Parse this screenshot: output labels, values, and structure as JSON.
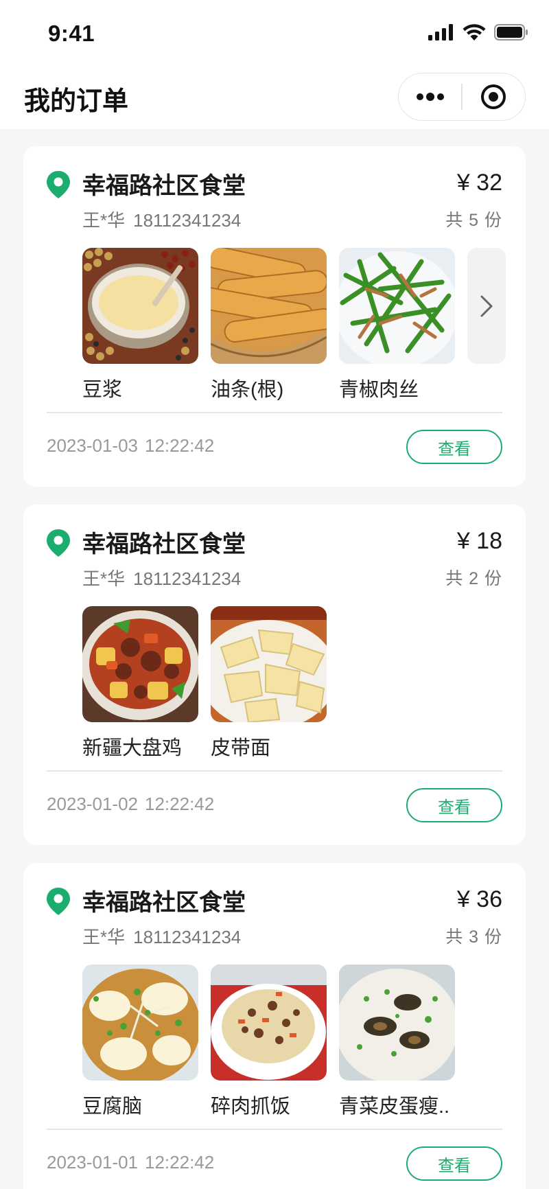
{
  "status_bar": {
    "time": "9:41"
  },
  "nav": {
    "title": "我的订单"
  },
  "colors": {
    "accent": "#1aad6e",
    "background": "#f6f6f6"
  },
  "orders": [
    {
      "store": "幸福路社区食堂",
      "customer_name": "王*华",
      "phone": "18112341234",
      "price": "¥ 32",
      "count": "共 5 份",
      "items": [
        {
          "name": "豆浆",
          "image": "soy-milk"
        },
        {
          "name": "油条(根)",
          "image": "fried-dough-sticks"
        },
        {
          "name": "青椒肉丝",
          "image": "green-pepper-pork"
        }
      ],
      "has_more": true,
      "date": "2023-01-03",
      "time": "12:22:42",
      "action": "查看"
    },
    {
      "store": "幸福路社区食堂",
      "customer_name": "王*华",
      "phone": "18112341234",
      "price": "¥ 18",
      "count": "共 2 份",
      "items": [
        {
          "name": "新疆大盘鸡",
          "image": "big-plate-chicken"
        },
        {
          "name": "皮带面",
          "image": "belt-noodles"
        }
      ],
      "has_more": false,
      "date": "2023-01-02",
      "time": "12:22:42",
      "action": "查看"
    },
    {
      "store": "幸福路社区食堂",
      "customer_name": "王*华",
      "phone": "18112341234",
      "price": "¥ 36",
      "count": "共 3 份",
      "items": [
        {
          "name": "豆腐脑",
          "image": "tofu-pudding"
        },
        {
          "name": "碎肉抓饭",
          "image": "pilaf"
        },
        {
          "name": "青菜皮蛋瘦..",
          "image": "century-egg-congee"
        }
      ],
      "has_more": false,
      "date": "2023-01-01",
      "time": "12:22:42",
      "action": "查看"
    }
  ]
}
